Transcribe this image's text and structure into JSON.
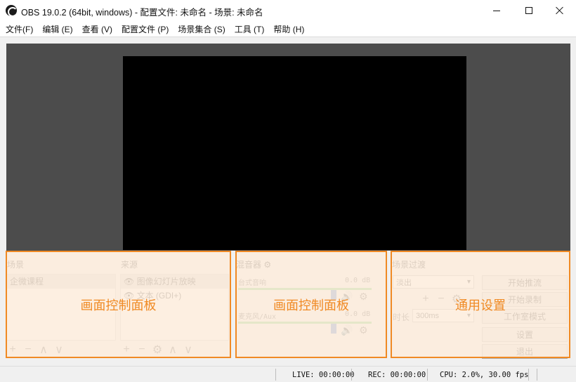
{
  "window": {
    "title": "OBS 19.0.2 (64bit, windows) - 配置文件: 未命名 - 场景: 未命名"
  },
  "menu": [
    "文件(F)",
    "编辑 (E)",
    "查看 (V)",
    "配置文件 (P)",
    "场景集合 (S)",
    "工具 (T)",
    "帮助 (H)"
  ],
  "scenes": {
    "label": "场景",
    "items": [
      "企微课程"
    ]
  },
  "sources": {
    "label": "来源",
    "items": [
      "图像幻灯片放映",
      "文本 (GDI+)"
    ]
  },
  "mixer": {
    "label": "混音器",
    "channels": [
      {
        "name": "台式音响",
        "db": "0.0 dB"
      },
      {
        "name": "麦克风/Aux",
        "db": "0.0 dB"
      }
    ]
  },
  "transitions": {
    "label": "场景过渡",
    "type": "淡出",
    "duration_label": "时长",
    "duration_value": "300ms"
  },
  "controls": {
    "buttons": [
      "开始推流",
      "开始录制",
      "工作室模式",
      "设置",
      "退出"
    ]
  },
  "overlays": {
    "left": "画面控制面板",
    "middle": "画面控制面板",
    "right": "通用设置",
    "border_color": "#f08a24"
  },
  "status": {
    "live": "LIVE: 00:00:00",
    "rec": "REC: 00:00:00",
    "cpu": "CPU: 2.0%, 30.00 fps"
  },
  "icons": {
    "add": "+",
    "remove": "−",
    "up": "∧",
    "down": "∨",
    "gear": "⚙",
    "eye": "👁",
    "speaker": "🔊"
  }
}
